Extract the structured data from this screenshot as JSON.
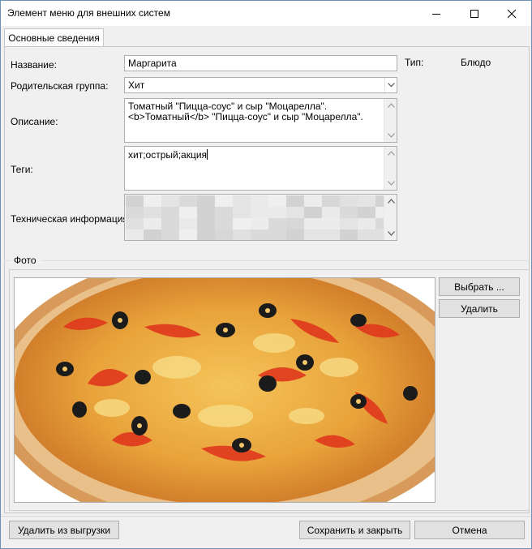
{
  "window": {
    "title": "Элемент меню для внешних систем"
  },
  "tabs": [
    {
      "label": "Основные сведения",
      "selected": true
    }
  ],
  "form": {
    "name": {
      "label": "Название:",
      "value": "Маргарита"
    },
    "type": {
      "label": "Тип:",
      "value": "Блюдо"
    },
    "parent_group": {
      "label": "Родительская группа:",
      "value": "Хит"
    },
    "description": {
      "label": "Описание:",
      "line1": "Томатный \"Пицца-соус\" и сыр \"Моцарелла\".",
      "line2": "<b>Томатный</b> \"Пицца-соус\" и сыр \"Моцарелла\"."
    },
    "tags": {
      "label": "Теги:",
      "value": "хит;острый;акция"
    },
    "tech_info": {
      "label": "Техническая информация:",
      "content": "redacted / pixelated"
    }
  },
  "photo": {
    "group_label": "Фото",
    "choose_button": "Выбрать ...",
    "delete_button": "Удалить"
  },
  "footer": {
    "remove_from_export": "Удалить из выгрузки",
    "save_and_close": "Сохранить и закрыть",
    "cancel": "Отмена"
  },
  "icons": {
    "minimize": "minimize-icon",
    "maximize": "maximize-icon",
    "close": "close-icon",
    "combo": "chevron-down-icon",
    "scroll_up": "scroll-up-icon",
    "scroll_down": "scroll-down-icon"
  },
  "colors": {
    "window_border": "#6f8fb5",
    "accent": "#0078d7",
    "panel": "#f0f0f0"
  }
}
